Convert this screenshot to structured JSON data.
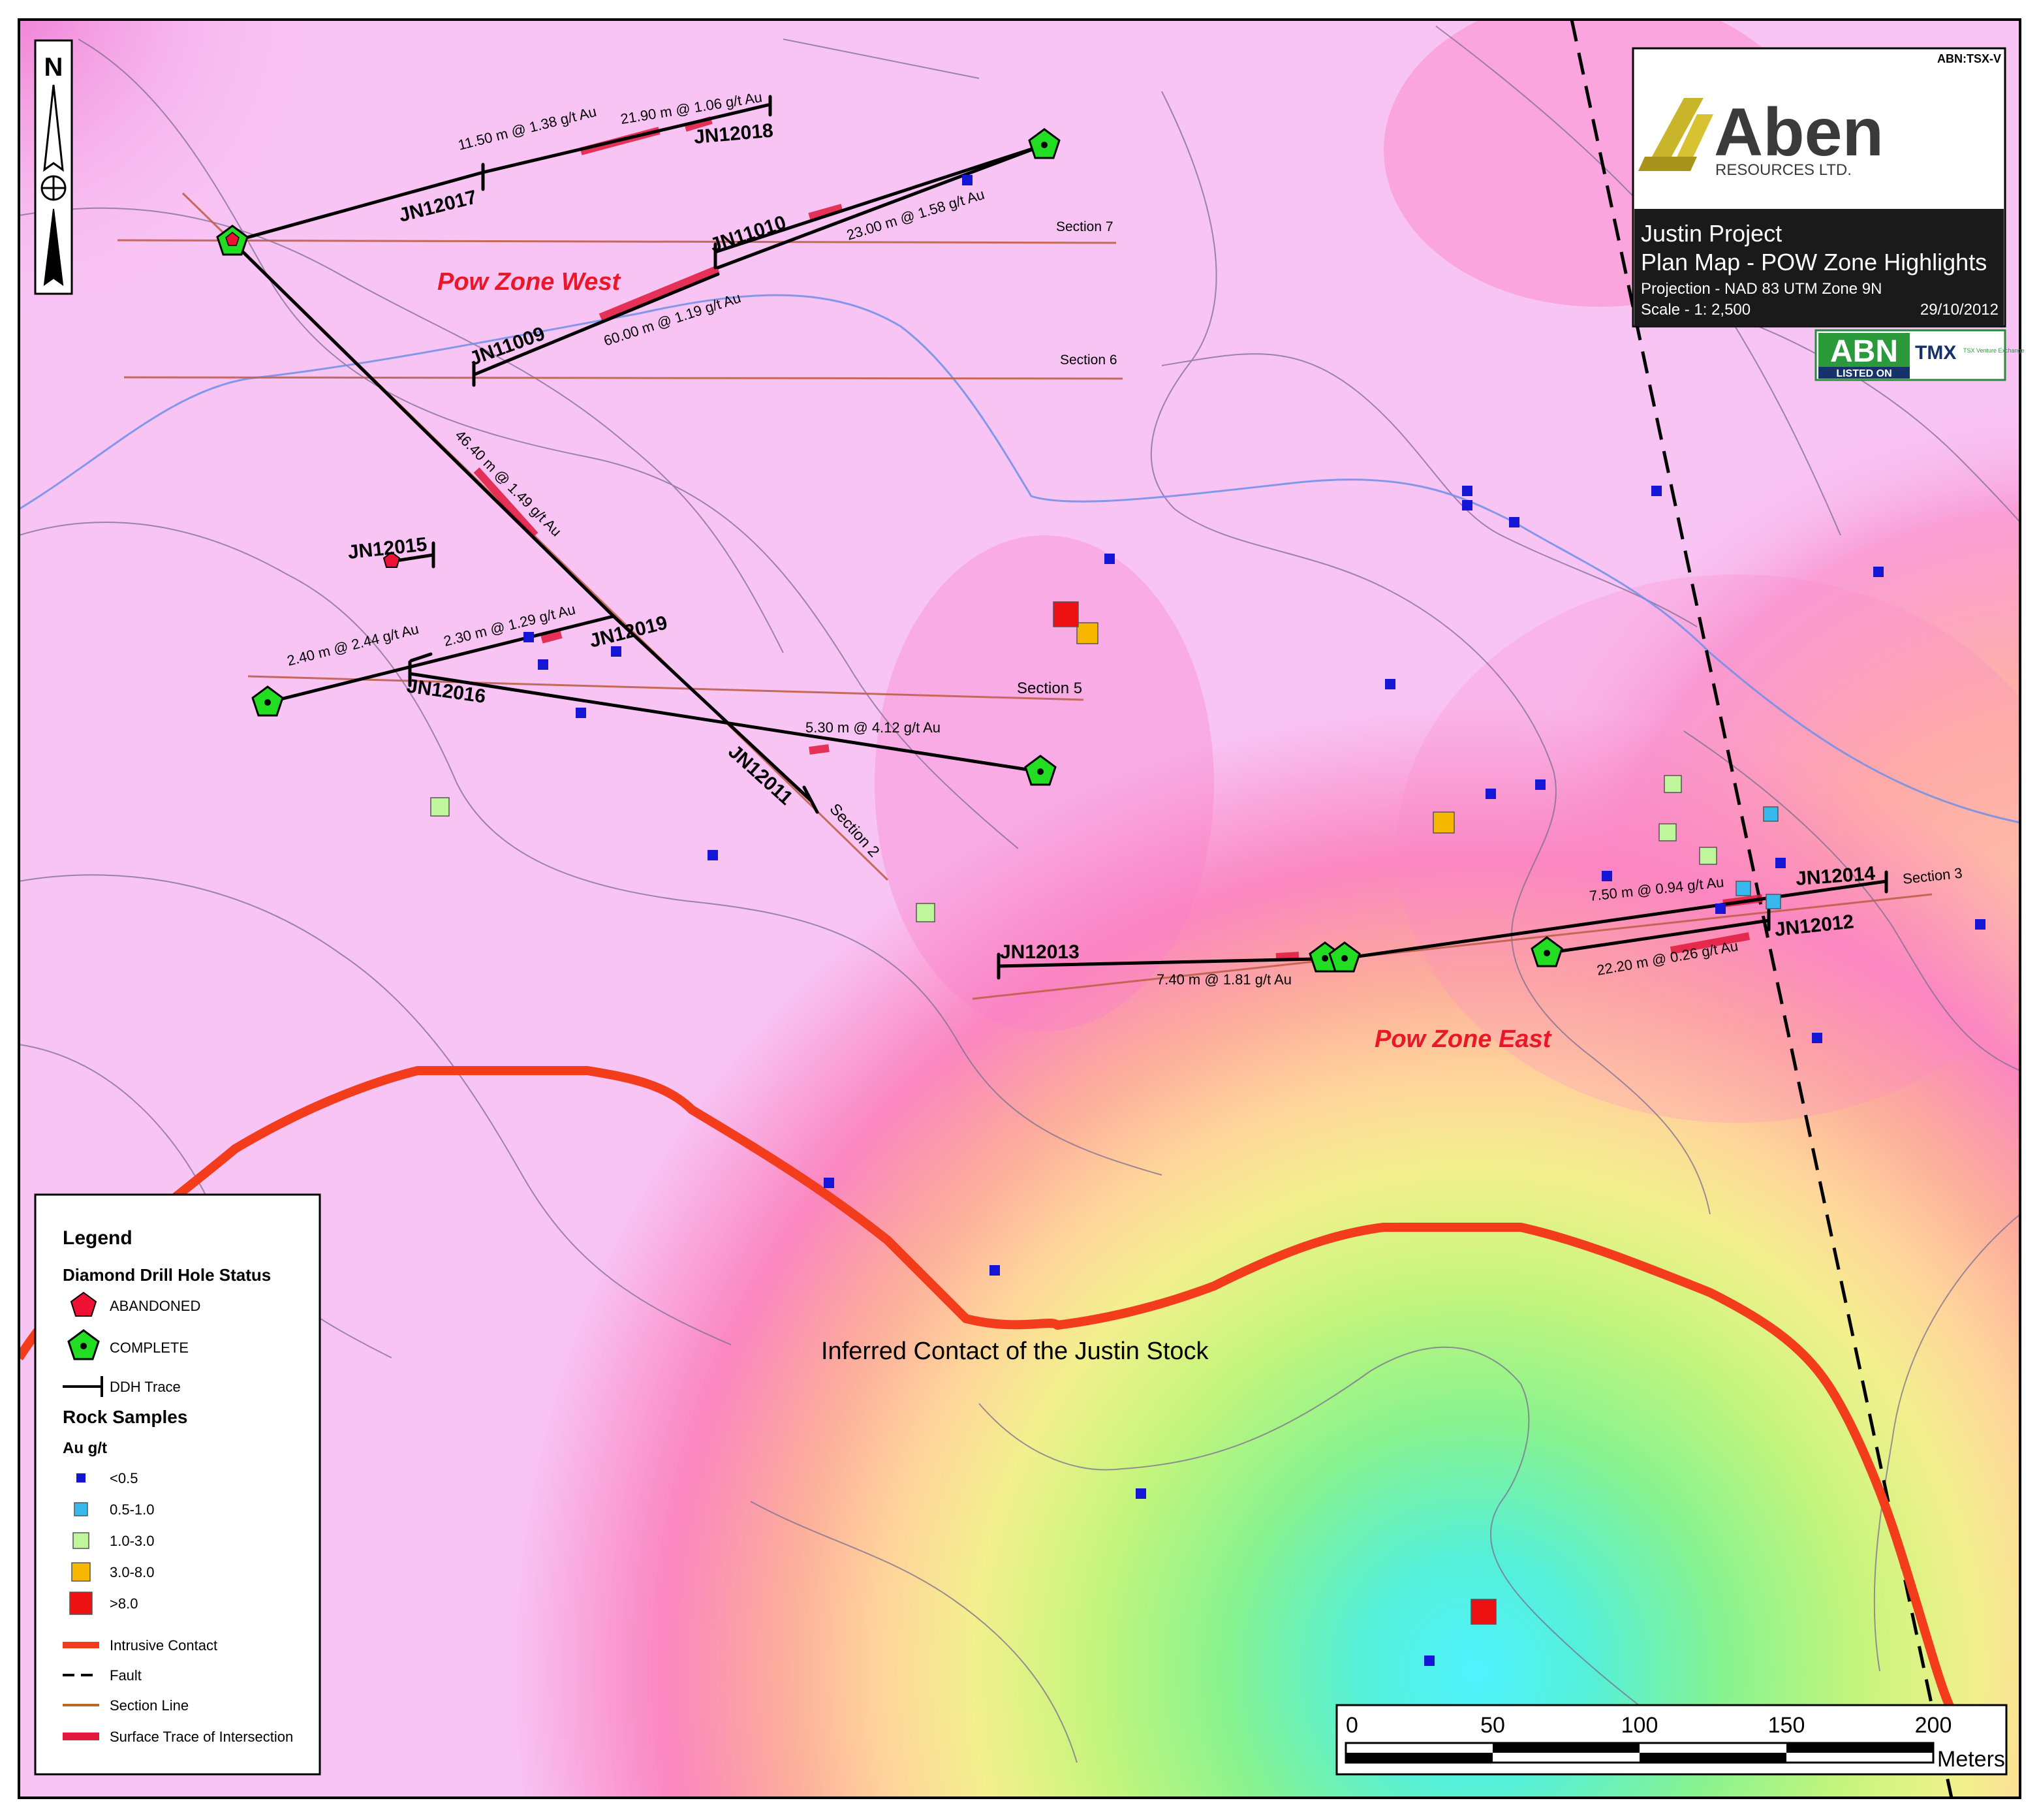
{
  "title_block": {
    "ticker": "ABN:TSX-V",
    "company_name": "Aben",
    "company_sub": "RESOURCES LTD.",
    "project": "Justin Project",
    "map_title": "Plan Map - POW Zone Highlights",
    "projection": "Projection - NAD 83 UTM Zone 9N",
    "scale": "Scale - 1: 2,500",
    "date": "29/10/2012",
    "badge_code": "ABN",
    "badge_listed": "LISTED ON",
    "badge_exchange": "TMX",
    "badge_exchange_sub": "TSX Venture Exchange"
  },
  "north_arrow": {
    "label": "N"
  },
  "zones": [
    "Pow Zone West",
    "Pow Zone East"
  ],
  "contact_label": "Inferred Contact of the Justin Stock",
  "sections": [
    "Section 7",
    "Section 6",
    "Section 5",
    "Section 2",
    "Section 3"
  ],
  "drill_holes": [
    "JN12017",
    "JN12018",
    "JN11010",
    "JN11009",
    "JN12015",
    "JN12019",
    "JN12016",
    "JN12011",
    "JN12013",
    "JN12014",
    "JN12012"
  ],
  "intercepts": [
    "11.50 m @ 1.38 g/t Au",
    "21.90 m @ 1.06 g/t Au",
    "23.00 m @ 1.58 g/t Au",
    "60.00 m @ 1.19 g/t Au",
    "46.40 m @ 1.49 g/t Au",
    "2.40 m @ 2.44 g/t Au",
    "2.30 m @ 1.29 g/t Au",
    "5.30 m @ 4.12 g/t Au",
    "7.50 m @ 0.94 g/t Au",
    "22.20 m @ 0.26 g/t Au",
    "7.40 m @ 1.81 g/t Au"
  ],
  "legend": {
    "title": "Legend",
    "ddh_heading": "Diamond Drill Hole Status",
    "abandoned": "ABANDONED",
    "complete": "COMPLETE",
    "ddh_trace": "DDH Trace",
    "rock_heading": "Rock Samples",
    "au_heading": "Au g/t",
    "classes": [
      {
        "label": "<0.5",
        "color": "#1515d6"
      },
      {
        "label": "0.5-1.0",
        "color": "#37b8ee"
      },
      {
        "label": "1.0-3.0",
        "color": "#bff59b"
      },
      {
        "label": "3.0-8.0",
        "color": "#f7b700"
      },
      {
        "label": ">8.0",
        "color": "#ee1111"
      }
    ],
    "intrusive_contact": "Intrusive Contact",
    "fault": "Fault",
    "section_line": "Section Line",
    "surface_trace": "Surface Trace of Intersection"
  },
  "scale_bar": {
    "ticks": [
      "0",
      "50",
      "100",
      "150",
      "200"
    ],
    "unit": "Meters"
  },
  "colors": {
    "intrusive_contact": "#f23c1c",
    "intersection": "#e2183c",
    "section_line": "#c0604a",
    "drill_complete": "#22dd22",
    "drill_abandoned": "#ee1133",
    "background_pink": "#f8c4f4"
  }
}
